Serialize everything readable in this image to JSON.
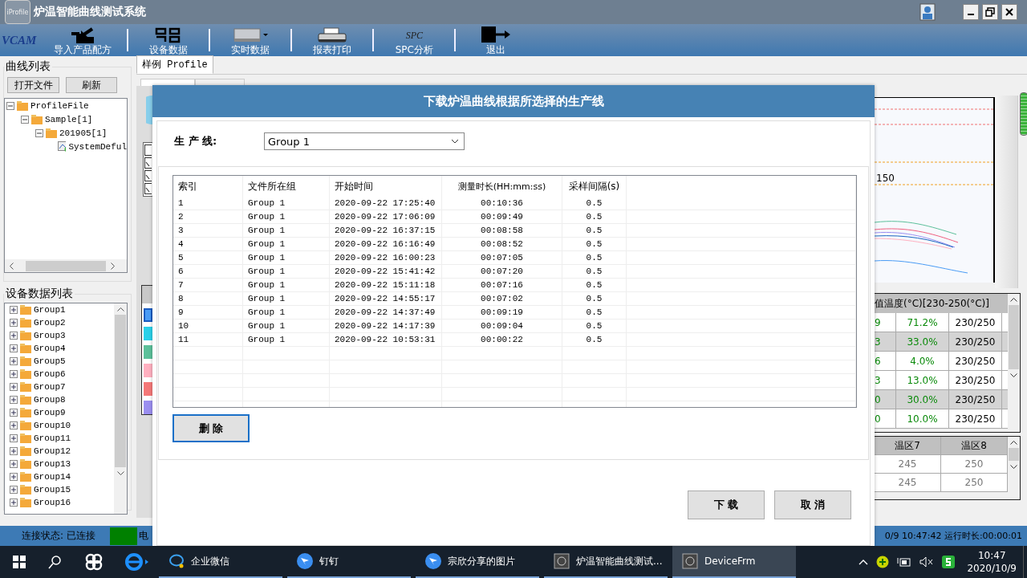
{
  "window": {
    "title": "炉温智能曲线测试系统",
    "app_icon_text": "iProfile"
  },
  "logo": {
    "text": "VCAM"
  },
  "toolbar": [
    {
      "label": "导入产品配方",
      "kind": "import"
    },
    {
      "label": "设备数据",
      "kind": "device"
    },
    {
      "label": "实时数据",
      "kind": "realtime"
    },
    {
      "label": "报表打印",
      "kind": "print"
    },
    {
      "label": "SPC分析",
      "kind": "spc",
      "icon_text": "SPC"
    },
    {
      "label": "退出",
      "kind": "exit"
    }
  ],
  "curve_list": {
    "title": "曲线列表",
    "buttons": [
      "打开文件",
      "刷新"
    ],
    "tree": [
      {
        "label": "ProfileFile",
        "kind": "folder",
        "expanded": true,
        "children": [
          {
            "label": "Sample[1]",
            "kind": "folder",
            "expanded": true,
            "children": [
              {
                "label": "201905[1]",
                "kind": "folder",
                "expanded": true,
                "children": [
                  {
                    "label": "SystemDeful",
                    "kind": "profile"
                  }
                ]
              }
            ]
          }
        ]
      }
    ]
  },
  "device_list": {
    "title": "设备数据列表",
    "groups": [
      {
        "label": "Group1",
        "expanded": false
      },
      {
        "label": "Group2",
        "expanded": false
      },
      {
        "label": "Group3",
        "expanded": false
      },
      {
        "label": "Group4",
        "expanded": false
      },
      {
        "label": "Group5",
        "expanded": false
      },
      {
        "label": "Group6",
        "expanded": false
      },
      {
        "label": "Group7",
        "expanded": false
      },
      {
        "label": "Group8",
        "expanded": false
      },
      {
        "label": "Group9",
        "expanded": false
      },
      {
        "label": "Group10",
        "expanded": false
      },
      {
        "label": "Group11",
        "expanded": false
      },
      {
        "label": "Group12",
        "expanded": false
      },
      {
        "label": "Group13",
        "expanded": false
      },
      {
        "label": "Group14",
        "expanded": false
      },
      {
        "label": "Group15",
        "expanded": false
      },
      {
        "label": "Group16",
        "expanded": false
      }
    ]
  },
  "profile_tab": {
    "label": "样例 Profile",
    "selected": true
  },
  "side_checkboxes": [
    {
      "checked": false
    },
    {
      "checked": true
    },
    {
      "checked": true
    },
    {
      "checked": true
    }
  ],
  "color_swatches": [
    {
      "color": "#4a9cf5",
      "selected": true
    },
    {
      "color": "#2ad0e8",
      "selected": false
    },
    {
      "color": "#5cc09a",
      "selected": false
    },
    {
      "color": "#ffb0c0",
      "selected": false
    },
    {
      "color": "#f57878",
      "selected": false
    },
    {
      "color": "#9b8ff0",
      "selected": false
    }
  ],
  "chart_label": "150",
  "stats_table": {
    "header": "值温度(°C)[230-250(°C)]",
    "rows": [
      {
        "cells": [
          "9",
          "71.2%",
          "230/250"
        ],
        "shaded": false
      },
      {
        "cells": [
          "3",
          "33.0%",
          "230/250"
        ],
        "shaded": true
      },
      {
        "cells": [
          "6",
          "4.0%",
          "230/250"
        ],
        "shaded": false
      },
      {
        "cells": [
          "3",
          "13.0%",
          "230/250"
        ],
        "shaded": false
      },
      {
        "cells": [
          "0",
          "30.0%",
          "230/250"
        ],
        "shaded": true
      },
      {
        "cells": [
          "0",
          "10.0%",
          "230/250"
        ],
        "shaded": false
      }
    ]
  },
  "zone_table": {
    "columns": [
      "温区7",
      "温区8"
    ],
    "rows": [
      [
        "245",
        "250"
      ],
      [
        "245",
        "250"
      ]
    ]
  },
  "status_bar": {
    "connection": "连接状态: 已连接",
    "connected": true,
    "label": "电",
    "clock": "0/9 10:47:42 运行时长:00:00:01"
  },
  "dialog": {
    "title": "下载炉温曲线根据所选择的生产线",
    "line_label": "生 产 线:",
    "line_value": "Group 1",
    "columns": [
      "索引",
      "文件所在组",
      "开始时间",
      "测量时长(HH:mm:ss)",
      "采样间隔(s)"
    ],
    "rows": [
      [
        "1",
        "Group 1",
        "2020-09-22 17:25:40",
        "00:10:36",
        "0.5"
      ],
      [
        "2",
        "Group 1",
        "2020-09-22 17:06:09",
        "00:09:49",
        "0.5"
      ],
      [
        "3",
        "Group 1",
        "2020-09-22 16:37:15",
        "00:08:58",
        "0.5"
      ],
      [
        "4",
        "Group 1",
        "2020-09-22 16:16:49",
        "00:08:52",
        "0.5"
      ],
      [
        "5",
        "Group 1",
        "2020-09-22 16:00:23",
        "00:07:05",
        "0.5"
      ],
      [
        "6",
        "Group 1",
        "2020-09-22 15:41:42",
        "00:07:20",
        "0.5"
      ],
      [
        "7",
        "Group 1",
        "2020-09-22 15:11:18",
        "00:07:16",
        "0.5"
      ],
      [
        "8",
        "Group 1",
        "2020-09-22 14:55:17",
        "00:07:02",
        "0.5"
      ],
      [
        "9",
        "Group 1",
        "2020-09-22 14:37:49",
        "00:09:19",
        "0.5"
      ],
      [
        "10",
        "Group 1",
        "2020-09-22 14:17:39",
        "00:09:04",
        "0.5"
      ],
      [
        "11",
        "Group 1",
        "2020-09-22 10:53:31",
        "00:00:22",
        "0.5"
      ]
    ],
    "delete_button": "删 除",
    "buttons": [
      "下 载",
      "取 消"
    ]
  },
  "taskbar": {
    "apps": [
      {
        "label": "企业微信",
        "kind": "wecom",
        "selected": false
      },
      {
        "label": "钉钉",
        "kind": "ding",
        "selected": false
      },
      {
        "label": "宗欣分享的图片",
        "kind": "ding",
        "selected": false
      },
      {
        "label": "炉温智能曲线测试...",
        "kind": "app",
        "selected": false
      },
      {
        "label": "DeviceFrm",
        "kind": "app",
        "selected": true
      }
    ],
    "time": "10:47",
    "date": "2020/10/9"
  }
}
